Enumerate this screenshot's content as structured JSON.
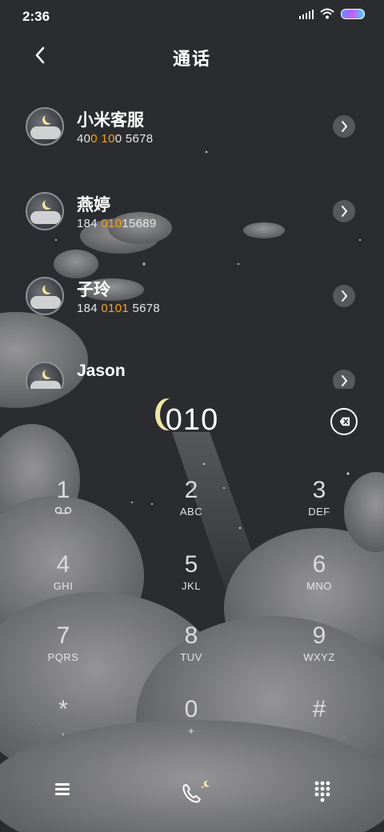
{
  "status_bar": {
    "time": "2:36"
  },
  "header": {
    "title": "通话"
  },
  "contacts": [
    {
      "name": "小米客服",
      "number_parts": [
        "40",
        "0",
        " ",
        "10",
        "0 5678"
      ]
    },
    {
      "name": "燕婷",
      "number_parts": [
        "184 ",
        "010",
        "15689"
      ]
    },
    {
      "name": "子玲",
      "number_parts": [
        "184 ",
        "0101",
        " 5678"
      ]
    },
    {
      "name": "Jason",
      "number_parts": []
    }
  ],
  "dial_input": "010",
  "keypad": [
    {
      "digit": "1",
      "letters": ""
    },
    {
      "digit": "2",
      "letters": "ABC"
    },
    {
      "digit": "3",
      "letters": "DEF"
    },
    {
      "digit": "4",
      "letters": "GHI"
    },
    {
      "digit": "5",
      "letters": "JKL"
    },
    {
      "digit": "6",
      "letters": "MNO"
    },
    {
      "digit": "7",
      "letters": "PQRS"
    },
    {
      "digit": "8",
      "letters": "TUV"
    },
    {
      "digit": "9",
      "letters": "WXYZ"
    },
    {
      "digit": "*",
      "letters": ","
    },
    {
      "digit": "0",
      "letters": "+"
    },
    {
      "digit": "#",
      "letters": ""
    }
  ],
  "icons": {
    "back": "chevron-left-icon",
    "delete": "backspace-icon",
    "voicemail": "voicemail-icon",
    "menu": "menu-icon",
    "call": "phone-icon",
    "keypad": "dialpad-icon",
    "row_action": "chevron-right-icon"
  },
  "colors": {
    "highlight": "#f2a31d",
    "background": "#2b2c30"
  }
}
